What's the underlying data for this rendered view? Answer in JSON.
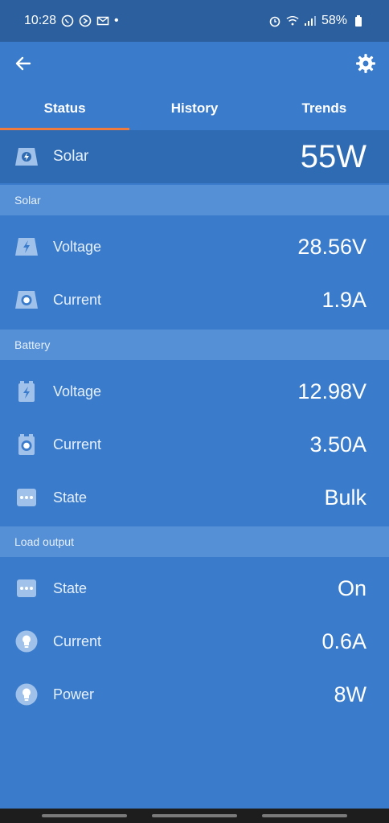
{
  "status_bar": {
    "time": "10:28",
    "dot": "•",
    "battery": "58%"
  },
  "tabs": [
    {
      "label": "Status",
      "active": true
    },
    {
      "label": "History",
      "active": false
    },
    {
      "label": "Trends",
      "active": false
    }
  ],
  "summary": {
    "label": "Solar",
    "value": "55W",
    "icon": "solar-panel-icon"
  },
  "sections": {
    "solar": {
      "title": "Solar",
      "rows": [
        {
          "label": "Voltage",
          "value": "28.56V",
          "icon": "bolt-icon"
        },
        {
          "label": "Current",
          "value": "1.9A",
          "icon": "current-icon"
        }
      ]
    },
    "battery": {
      "title": "Battery",
      "rows": [
        {
          "label": "Voltage",
          "value": "12.98V",
          "icon": "battery-bolt-icon"
        },
        {
          "label": "Current",
          "value": "3.50A",
          "icon": "battery-current-icon"
        },
        {
          "label": "State",
          "value": "Bulk",
          "icon": "more-dots-icon"
        }
      ]
    },
    "load": {
      "title": "Load output",
      "rows": [
        {
          "label": "State",
          "value": "On",
          "icon": "more-dots-icon"
        },
        {
          "label": "Current",
          "value": "0.6A",
          "icon": "bulb-icon"
        },
        {
          "label": "Power",
          "value": "8W",
          "icon": "bulb-icon"
        }
      ]
    }
  },
  "colors": {
    "primary": "#3a7ccb",
    "dark": "#2b5f9e",
    "section": "#5590d6",
    "accent": "#f07b3f"
  }
}
